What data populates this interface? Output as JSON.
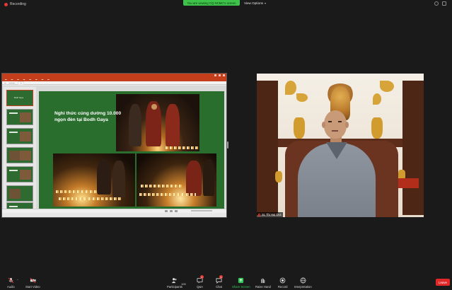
{
  "top_bar": {
    "recording_label": "Recording",
    "viewing_banner": "You are viewing CQ NCMC's screen",
    "view_options_label": "View Options",
    "view_options_chevron": "chevron-down-icon"
  },
  "shared_screen": {
    "app_title": "",
    "slide": {
      "title": "Nghi thức cúng dường 10.000 ngọn đèn tại Bodh Gaya"
    },
    "thumbnails": [
      {
        "title": "Bodh Gaya"
      },
      {
        "title": ""
      },
      {
        "title": ""
      },
      {
        "title": ""
      },
      {
        "title": ""
      },
      {
        "title": ""
      },
      {
        "title": ""
      }
    ]
  },
  "video": {
    "participant_name": "Sc Thi Hai Duc",
    "mic_state": "muted",
    "mic_icon": "mic-muted-icon"
  },
  "toolbar": {
    "audio_label": "Audio",
    "start_video_label": "Start Video",
    "participants_label": "Participants",
    "participants_count": "105",
    "qa_label": "Q&A",
    "qa_badge": "2",
    "chat_label": "Chat",
    "chat_badge": "3",
    "share_screen_label": "Share Screen",
    "raise_hand_label": "Raise Hand",
    "record_label": "Record",
    "interpretation_label": "Interpretation",
    "leave_label": "Leave"
  },
  "colors": {
    "accent_green": "#3ec34a",
    "leave_red": "#e02828",
    "slide_green": "#2a6e2d",
    "ppt_orange": "#c43e1c"
  }
}
